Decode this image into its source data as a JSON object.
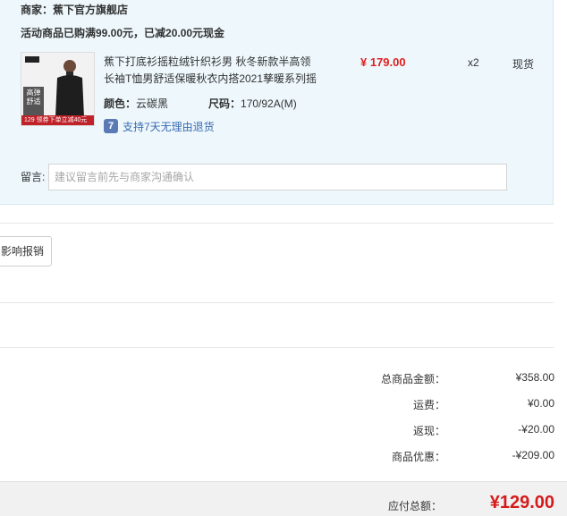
{
  "shop": {
    "label": "商家：蕉下官方旗舰店"
  },
  "promotion": {
    "text": "活动商品已购满99.00元，已减20.00元现金"
  },
  "item": {
    "thumb_tag": "高弹 舒适",
    "thumb_price": "129 领券下单立减40元",
    "title": "蕉下打底衫摇粒绒针织衫男 秋冬新款半高领长袖T恤男舒适保暖秋衣内搭2021孳暖系列摇",
    "color_label": "颜色：",
    "color_value": "云碳黑",
    "size_label": "尺码：",
    "size_value": "170/92A(M)",
    "return_policy_icon": "7",
    "return_policy": "支持7天无理由退货",
    "price": "¥ 179.00",
    "quantity": "x2",
    "stock_status": "现货"
  },
  "memo": {
    "label": "留言:",
    "placeholder": "建议留言前先与商家沟通确认"
  },
  "invoice": {
    "button_label": "影响报销"
  },
  "summary": {
    "rows": [
      {
        "label": "总商品金额：",
        "value": "¥358.00"
      },
      {
        "label": "运费：",
        "value": "¥0.00"
      },
      {
        "label": "返现：",
        "value": "-¥20.00"
      },
      {
        "label": "商品优惠：",
        "value": "-¥209.00"
      }
    ],
    "total_label": "应付总额：",
    "total_value": "¥129.00"
  },
  "colors": {
    "card_bg": "#edf7fc",
    "price_red": "#e02020",
    "link_blue": "#3b6bb0"
  }
}
